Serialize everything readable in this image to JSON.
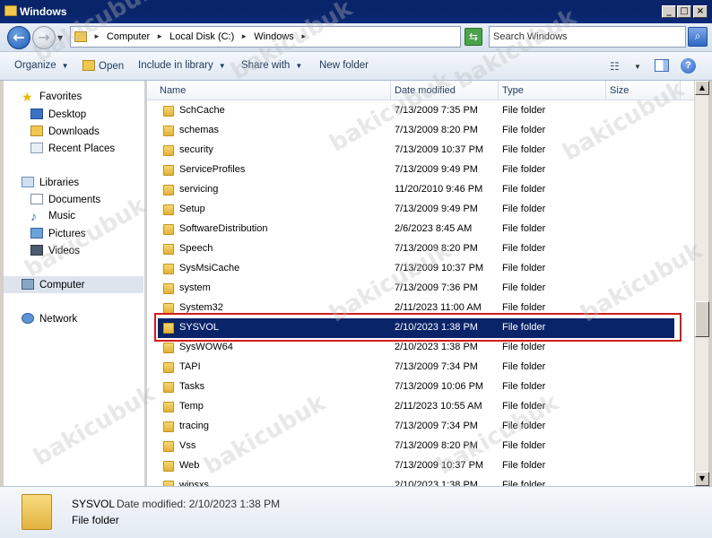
{
  "window": {
    "title": "Windows"
  },
  "address": {
    "crumbs": [
      "Computer",
      "Local Disk (C:)",
      "Windows"
    ]
  },
  "search": {
    "placeholder": "Search Windows"
  },
  "toolbar": {
    "organize": "Organize",
    "open": "Open",
    "include_in_library": "Include in library",
    "share_with": "Share with",
    "new_folder": "New folder"
  },
  "nav": {
    "favorites": "Favorites",
    "desktop": "Desktop",
    "downloads": "Downloads",
    "recent_places": "Recent Places",
    "libraries": "Libraries",
    "documents": "Documents",
    "music": "Music",
    "pictures": "Pictures",
    "videos": "Videos",
    "computer": "Computer",
    "network": "Network"
  },
  "columns": {
    "name": "Name",
    "date_modified": "Date modified",
    "type": "Type",
    "size": "Size"
  },
  "files": [
    {
      "name": "SchCache",
      "date": "7/13/2009 7:35 PM",
      "type": "File folder"
    },
    {
      "name": "schemas",
      "date": "7/13/2009 8:20 PM",
      "type": "File folder"
    },
    {
      "name": "security",
      "date": "7/13/2009 10:37 PM",
      "type": "File folder"
    },
    {
      "name": "ServiceProfiles",
      "date": "7/13/2009 9:49 PM",
      "type": "File folder"
    },
    {
      "name": "servicing",
      "date": "11/20/2010 9:46 PM",
      "type": "File folder"
    },
    {
      "name": "Setup",
      "date": "7/13/2009 9:49 PM",
      "type": "File folder"
    },
    {
      "name": "SoftwareDistribution",
      "date": "2/6/2023 8:45 AM",
      "type": "File folder"
    },
    {
      "name": "Speech",
      "date": "7/13/2009 8:20 PM",
      "type": "File folder"
    },
    {
      "name": "SysMsiCache",
      "date": "7/13/2009 10:37 PM",
      "type": "File folder"
    },
    {
      "name": "system",
      "date": "7/13/2009 7:36 PM",
      "type": "File folder"
    },
    {
      "name": "System32",
      "date": "2/11/2023 11:00 AM",
      "type": "File folder"
    },
    {
      "name": "SYSVOL",
      "date": "2/10/2023 1:38 PM",
      "type": "File folder",
      "selected": true
    },
    {
      "name": "SysWOW64",
      "date": "2/10/2023 1:38 PM",
      "type": "File folder"
    },
    {
      "name": "TAPI",
      "date": "7/13/2009 7:34 PM",
      "type": "File folder"
    },
    {
      "name": "Tasks",
      "date": "7/13/2009 10:06 PM",
      "type": "File folder"
    },
    {
      "name": "Temp",
      "date": "2/11/2023 10:55 AM",
      "type": "File folder"
    },
    {
      "name": "tracing",
      "date": "7/13/2009 7:34 PM",
      "type": "File folder"
    },
    {
      "name": "Vss",
      "date": "7/13/2009 8:20 PM",
      "type": "File folder"
    },
    {
      "name": "Web",
      "date": "7/13/2009 10:37 PM",
      "type": "File folder"
    },
    {
      "name": "winsxs",
      "date": "2/10/2023 1:38 PM",
      "type": "File folder"
    }
  ],
  "details": {
    "name": "SYSVOL",
    "date_label": "Date modified: 2/10/2023 1:38 PM",
    "type": "File folder"
  },
  "watermark": "bakicubuk"
}
